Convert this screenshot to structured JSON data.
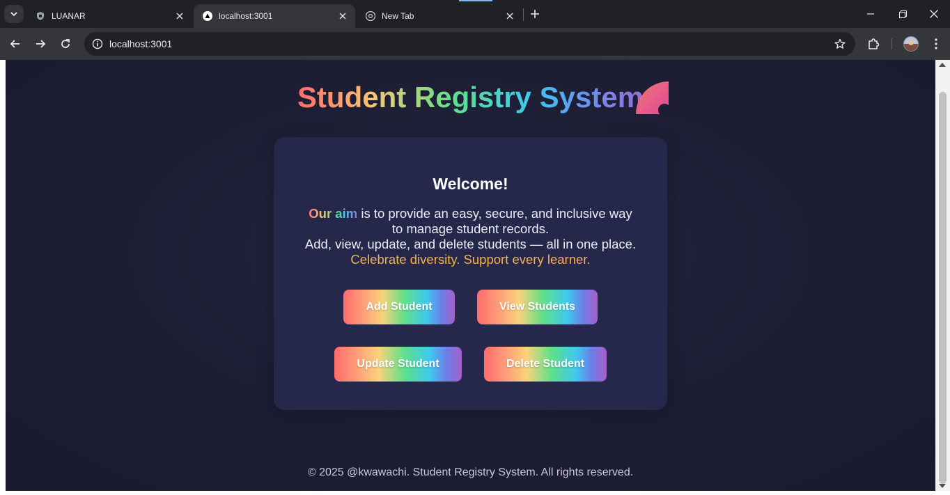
{
  "browser": {
    "tabs": [
      {
        "title": "LUANAR",
        "icon": "shield-crest-icon",
        "active": false
      },
      {
        "title": "localhost:3001",
        "icon": "triangle-logo-icon",
        "active": true
      },
      {
        "title": "New Tab",
        "icon": "chrome-icon",
        "active": false
      }
    ],
    "url": "localhost:3001"
  },
  "page": {
    "title": "Student Registry System",
    "welcome": "Welcome!",
    "aim_highlight": "Our aim",
    "description_line1_rest": " is to provide an easy, secure, and inclusive way",
    "description_line2": "to manage student records.",
    "description_line3": "Add, view, update, and delete students — all in one place.",
    "description_line4": "Celebrate diversity. Support every learner.",
    "buttons": {
      "add": "Add Student",
      "view": "View Students",
      "update": "Update Student",
      "delete": "Delete Student"
    },
    "footer": "© 2025 @kwawachi. Student Registry System. All rights reserved."
  },
  "colors": {
    "page_bg": "#1d1e34",
    "card_bg": "#25284a",
    "accent_orange": "#f7b24a",
    "gradient": [
      "#ff6b6b",
      "#f8d37a",
      "#5ee08a",
      "#3fc8f0",
      "#a55fc8"
    ]
  }
}
